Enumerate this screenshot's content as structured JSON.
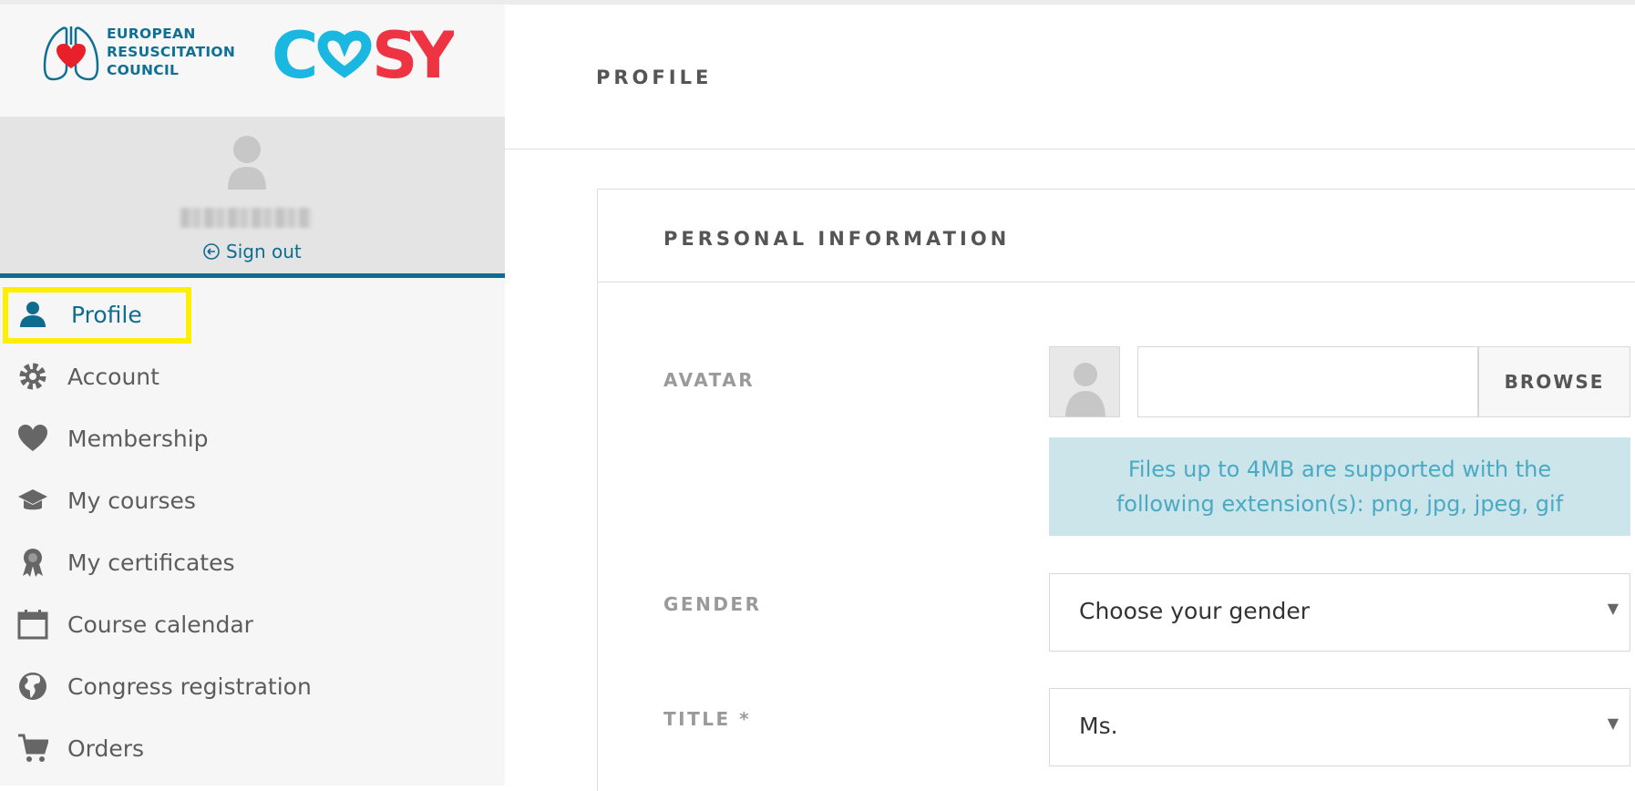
{
  "brand": {
    "org_line1": "EUROPEAN",
    "org_line2": "RESUSCITATION",
    "org_line3": "COUNCIL",
    "product": "COSY"
  },
  "user_panel": {
    "sign_out_label": "Sign out"
  },
  "sidebar": {
    "items": [
      {
        "label": "Profile",
        "icon": "user-icon",
        "active": true
      },
      {
        "label": "Account",
        "icon": "gear-icon"
      },
      {
        "label": "Membership",
        "icon": "heart-icon"
      },
      {
        "label": "My courses",
        "icon": "graduation-cap-icon"
      },
      {
        "label": "My certificates",
        "icon": "award-icon"
      },
      {
        "label": "Course calendar",
        "icon": "calendar-icon"
      },
      {
        "label": "Congress registration",
        "icon": "globe-icon"
      },
      {
        "label": "Orders",
        "icon": "cart-icon"
      }
    ]
  },
  "page": {
    "title": "PROFILE"
  },
  "personal_info": {
    "title": "PERSONAL INFORMATION",
    "avatar_label": "AVATAR",
    "browse_label": "BROWSE",
    "file_hint": "Files up to 4MB are supported with the following extension(s): png, jpg, jpeg, gif",
    "gender_label": "GENDER",
    "gender_value": "Choose your gender",
    "title_label": "TITLE *",
    "title_value": "Ms."
  },
  "colors": {
    "accent": "#0f6c8f",
    "highlight": "#ffee00",
    "info_bg": "#cbe5ea",
    "info_text": "#4aaac4",
    "cosy_cyan": "#1ab7e0",
    "cosy_red": "#ee3342"
  }
}
